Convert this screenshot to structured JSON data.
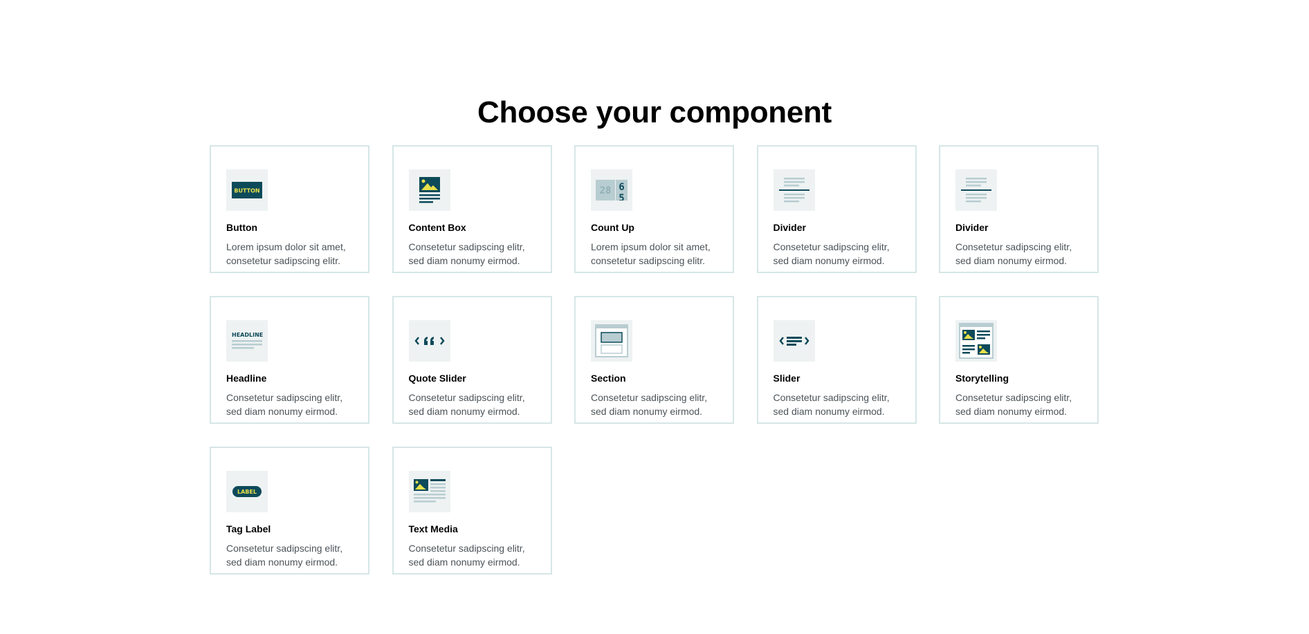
{
  "page": {
    "title": "Choose your component"
  },
  "colors": {
    "accent_dark_teal": "#0d4a5a",
    "accent_yellow": "#e6e04a",
    "icon_light": "#b8cdd1",
    "thumb_bg": "#eef2f2",
    "card_border": "#d6e6e6",
    "description_text": "#4c5358"
  },
  "thumb_text": {
    "button": "BUTTON",
    "headline": "HEADLINE",
    "label": "LABEL",
    "count_a": "28",
    "count_b": "6",
    "count_c": "5"
  },
  "components": [
    {
      "title": "Button",
      "description": "Lorem ipsum dolor sit amet, consetetur sadipscing elitr.",
      "icon": "button-icon"
    },
    {
      "title": "Content Box",
      "description": "Consetetur sadipscing elitr, sed diam nonumy eirmod.",
      "icon": "content-box-icon"
    },
    {
      "title": "Count Up",
      "description": "Lorem ipsum dolor sit amet, consetetur sadipscing elitr.",
      "icon": "count-up-icon"
    },
    {
      "title": "Divider",
      "description": "Consetetur sadipscing elitr, sed diam nonumy eirmod.",
      "icon": "divider-icon"
    },
    {
      "title": "Divider",
      "description": "Consetetur sadipscing elitr, sed diam nonumy eirmod.",
      "icon": "divider-icon"
    },
    {
      "title": "Headline",
      "description": "Consetetur sadipscing elitr, sed diam nonumy eirmod.",
      "icon": "headline-icon"
    },
    {
      "title": "Quote Slider",
      "description": "Consetetur sadipscing elitr, sed diam nonumy eirmod.",
      "icon": "quote-slider-icon"
    },
    {
      "title": "Section",
      "description": "Consetetur sadipscing elitr, sed diam nonumy eirmod.",
      "icon": "section-icon"
    },
    {
      "title": "Slider",
      "description": "Consetetur sadipscing elitr, sed diam nonumy eirmod.",
      "icon": "slider-icon"
    },
    {
      "title": "Storytelling",
      "description": "Consetetur sadipscing elitr, sed diam nonumy eirmod.",
      "icon": "storytelling-icon"
    },
    {
      "title": "Tag Label",
      "description": "Consetetur sadipscing elitr, sed diam nonumy eirmod.",
      "icon": "tag-label-icon"
    },
    {
      "title": "Text Media",
      "description": "Consetetur sadipscing elitr, sed diam nonumy eirmod.",
      "icon": "text-media-icon"
    }
  ]
}
